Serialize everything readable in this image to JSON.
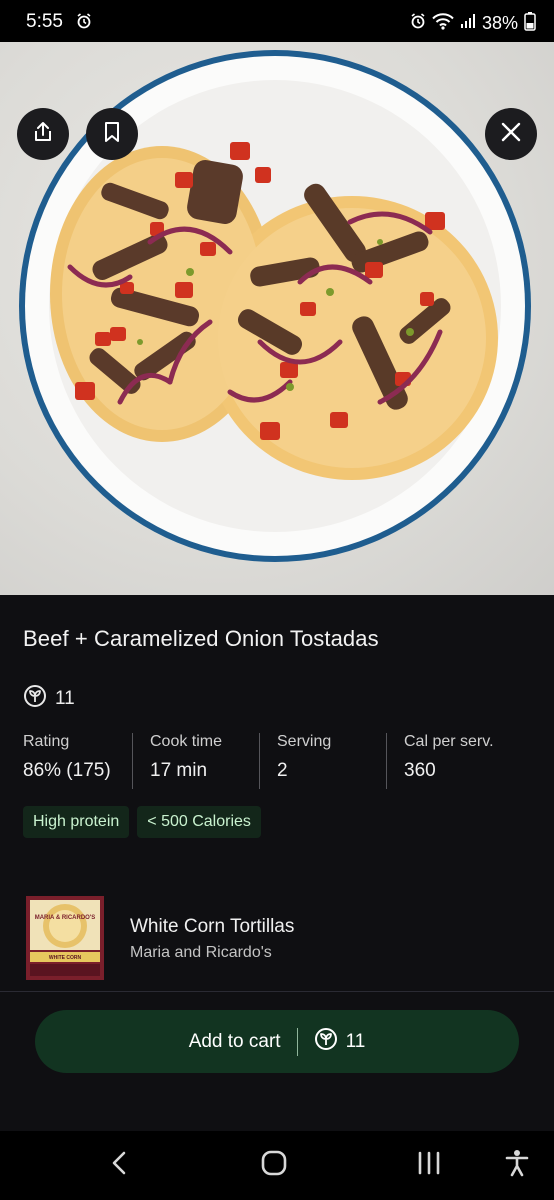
{
  "status_bar": {
    "time": "5:55",
    "battery": "38%"
  },
  "hero": {
    "image_alt": "Beef and caramelized onion tostadas on a white plate"
  },
  "recipe": {
    "title": "Beef + Caramelized Onion Tostadas",
    "points": "11",
    "stats": [
      {
        "label": "Rating",
        "value": "86% (175)"
      },
      {
        "label": "Cook time",
        "value": "17 min"
      },
      {
        "label": "Serving",
        "value": "2"
      },
      {
        "label": "Cal per serv.",
        "value": "360"
      }
    ],
    "tags": [
      "High protein",
      "< 500 Calories"
    ]
  },
  "product": {
    "name": "White Corn Tortillas",
    "brand": "Maria and Ricardo's",
    "package_logo_text": "MARIA & RICARDO'S",
    "package_variant_text": "WHITE CORN"
  },
  "cart": {
    "label": "Add to cart",
    "points": "11"
  },
  "colors": {
    "accent_green": "#123421",
    "tag_bg": "#13261a",
    "tag_text": "#c9f2cf",
    "background": "#0f0f12"
  },
  "icons": [
    "alarm-icon",
    "wifi-icon",
    "signal-icon",
    "battery-icon",
    "share-icon",
    "bookmark-icon",
    "close-icon",
    "points-icon",
    "back-icon",
    "home-icon",
    "recents-icon",
    "accessibility-icon"
  ]
}
